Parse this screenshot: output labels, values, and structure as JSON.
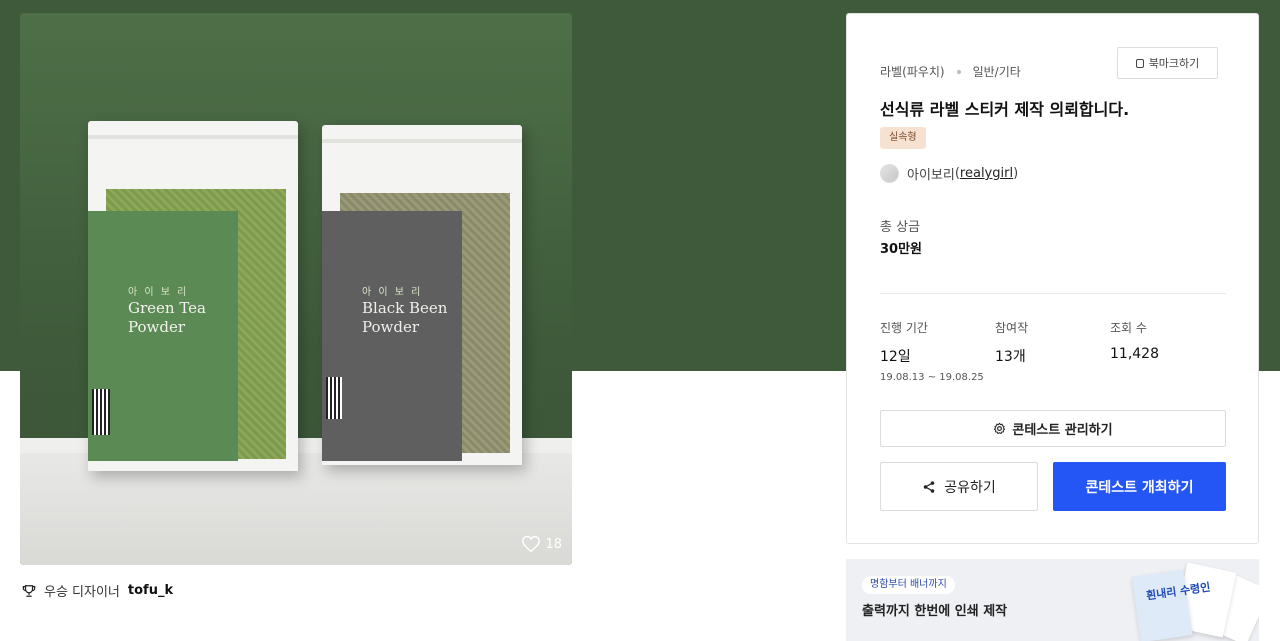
{
  "product": {
    "green_brand": "아 이 보 리",
    "green_name": "Green Tea Powder",
    "black_brand": "아 이 보 리",
    "black_name": "Black Been Powder",
    "likes": "18"
  },
  "winner": {
    "label": "우승 디자이너",
    "name": "tofu_k"
  },
  "card": {
    "category": "라벨(파우치)",
    "subcategory": "일반/기타",
    "bookmark_label": "북마크하기",
    "title": "선식류 라벨 스티커 제작 의뢰합니다.",
    "badge": "실속형",
    "host_name": "아이보리",
    "host_id": "realygirl",
    "prize_label": "총 상금",
    "prize_value": "30만원",
    "stats": {
      "period_label": "진행 기간",
      "period_value": "12일",
      "period_dates": "19.08.13 ~ 19.08.25",
      "entries_label": "참여작",
      "entries_value": "13개",
      "views_label": "조회 수",
      "views_value": "11,428"
    },
    "manage_label": "콘테스트 관리하기",
    "share_label": "공유하기",
    "host_button_label": "콘테스트 개최하기"
  },
  "ad": {
    "tag": "명함부터 배너까지",
    "text": "출력까지 한번에 인쇄 제작",
    "art_text": "흰내리 수령인"
  },
  "colors": {
    "hero_green": "#3f5a3b",
    "accent_blue": "#2456f5",
    "badge_bg": "#f7e2d2"
  }
}
